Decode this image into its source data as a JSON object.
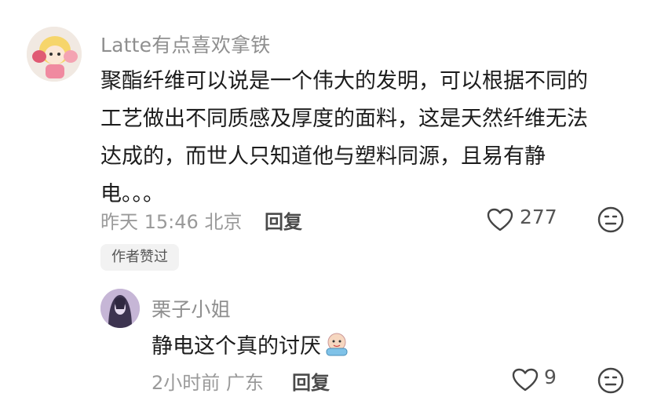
{
  "comment": {
    "username": "Latte有点喜欢拿铁",
    "lines": [
      "聚酯纤维可以说是一个伟大的发明，可以根据不同的",
      "工艺做出不同质感及厚度的面料，这是天然纤维无法",
      "达成的，而世人只知道他与塑料同源，且易有静",
      "电。。。"
    ],
    "time": "昨天 15:46",
    "location": "北京",
    "reply_label": "回复",
    "like_count": "277",
    "badge": "作者赞过"
  },
  "reply": {
    "username": "栗子小姐",
    "text": "静电这个真的讨厌",
    "time": "2小时前",
    "location": "广东",
    "reply_label": "回复",
    "like_count": "9"
  },
  "icons": {
    "like": "heart-outline-icon",
    "dislike": "neutral-face-icon",
    "emoji": "crying-face-emoji"
  },
  "colors": {
    "username": "#8f8f8f",
    "text": "#1c1c1c",
    "meta": "#9a9a9a",
    "badge_bg": "#f2f2f2"
  }
}
